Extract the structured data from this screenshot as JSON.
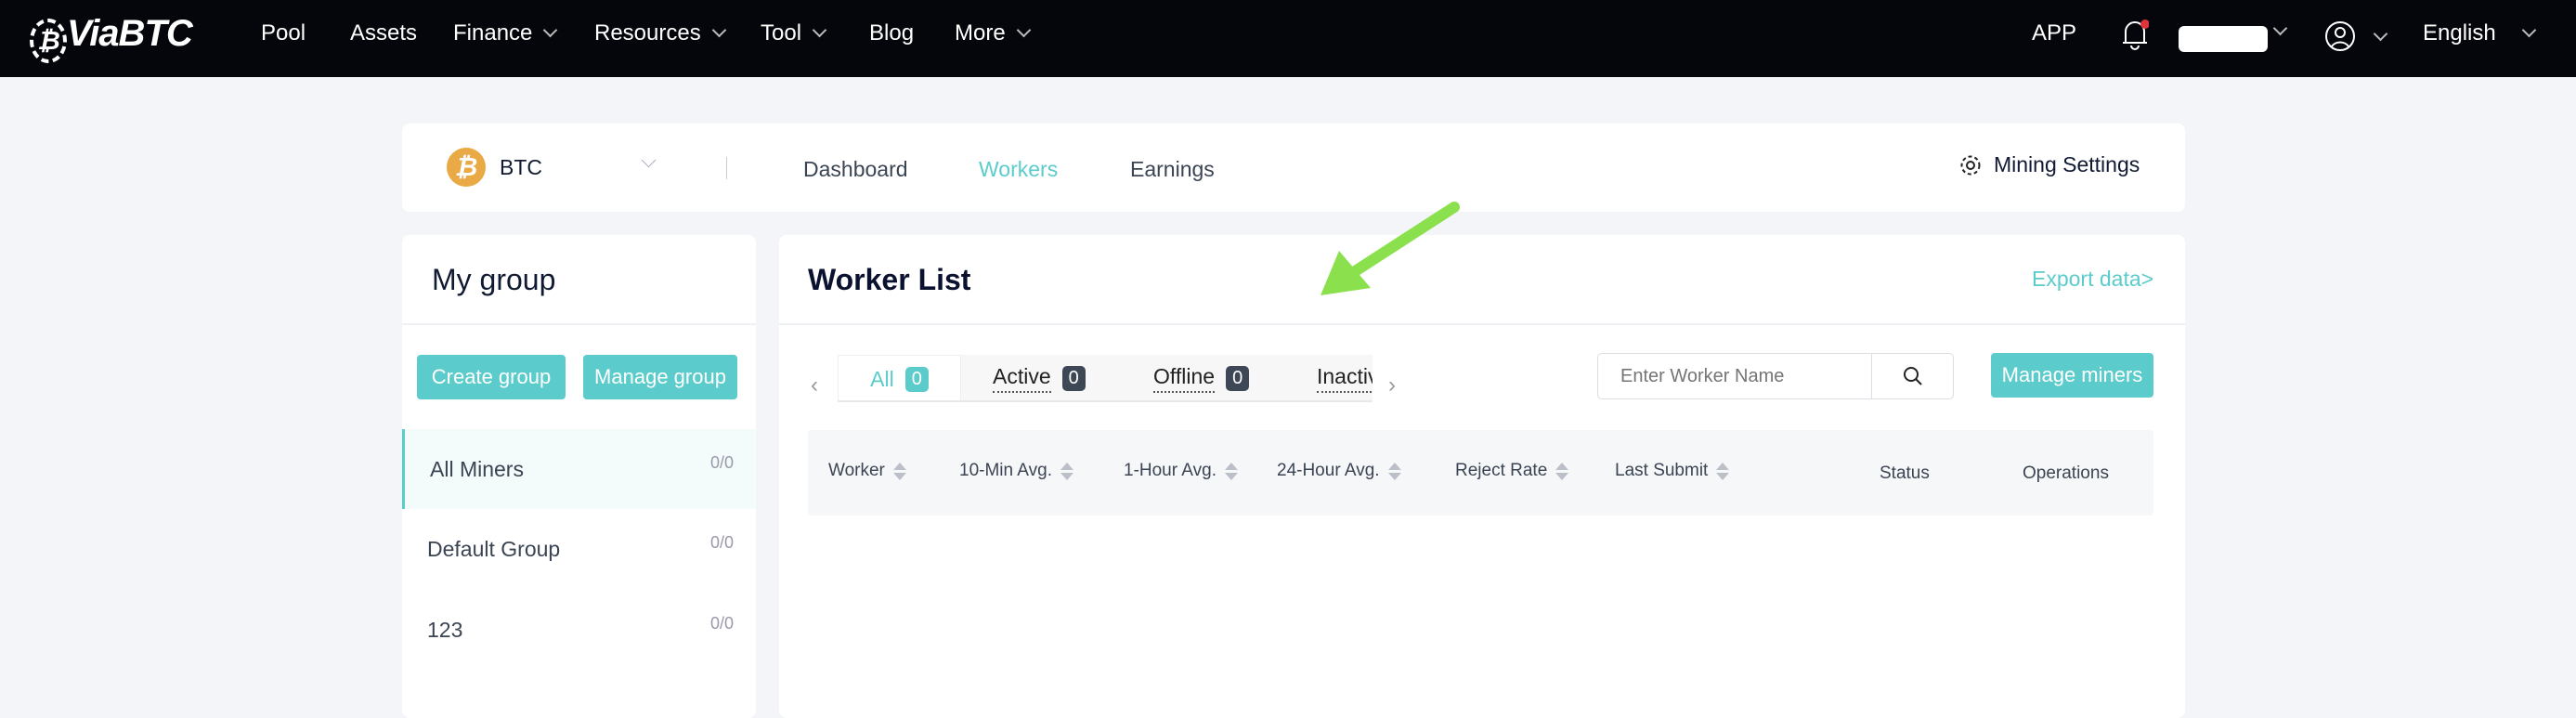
{
  "nav": {
    "logo": "ViaBTC",
    "items": [
      {
        "label": "Pool",
        "active": true,
        "dropdown": false
      },
      {
        "label": "Assets",
        "dropdown": false
      },
      {
        "label": "Finance",
        "dropdown": true
      },
      {
        "label": "Resources",
        "dropdown": true
      },
      {
        "label": "Tool",
        "dropdown": true
      },
      {
        "label": "Blog",
        "dropdown": false
      },
      {
        "label": "More",
        "dropdown": true
      }
    ],
    "app": "APP",
    "language": "English",
    "notification_dot_color": "#e0343c"
  },
  "coinbar": {
    "coin": "BTC",
    "tabs": [
      "Dashboard",
      "Workers",
      "Earnings"
    ],
    "active_tab": "Workers",
    "settings": "Mining Settings"
  },
  "groups": {
    "title": "My group",
    "create": "Create group",
    "manage": "Manage group",
    "items": [
      {
        "name": "All Miners",
        "count": "0/0",
        "active": true
      },
      {
        "name": "Default Group",
        "count": "0/0"
      },
      {
        "name": "123",
        "count": "0/0"
      }
    ]
  },
  "workers": {
    "title": "Worker List",
    "export": "Export data>",
    "tabs": [
      {
        "label": "All",
        "count": "0"
      },
      {
        "label": "Active",
        "count": "0"
      },
      {
        "label": "Offline",
        "count": "0"
      },
      {
        "label": "Inactive",
        "count": ""
      }
    ],
    "search_placeholder": "Enter Worker Name",
    "manage_miners": "Manage miners",
    "columns": [
      "Worker",
      "10-Min Avg.",
      "1-Hour Avg.",
      "24-Hour Avg.",
      "Reject Rate",
      "Last Submit",
      "Status",
      "Operations"
    ]
  },
  "colors": {
    "accent": "#5ccbcb",
    "nav_bg": "#05060b",
    "annotation_arrow": "#8be04e"
  }
}
